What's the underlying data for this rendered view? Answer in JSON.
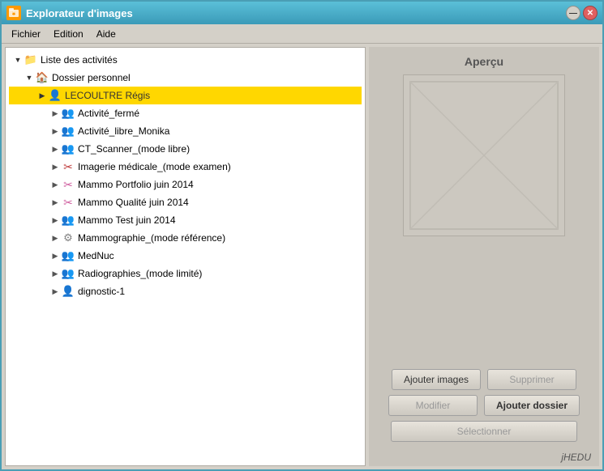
{
  "window": {
    "title": "Explorateur d'images",
    "icon": "🗂",
    "min_btn": "—",
    "close_btn": "✕"
  },
  "menubar": {
    "items": [
      {
        "label": "Fichier"
      },
      {
        "label": "Edition"
      },
      {
        "label": "Aide"
      }
    ]
  },
  "tree": {
    "root_label": "Liste des activités",
    "nodes": [
      {
        "id": "dossier_personnel",
        "label": "Dossier personnel",
        "level": 1,
        "expanded": true,
        "icon": "🏠",
        "icon_class": "icon-home"
      },
      {
        "id": "lecoultre",
        "label": "LECOULTRE Régis",
        "level": 2,
        "expanded": true,
        "icon": "👤",
        "icon_class": "icon-user-orange",
        "selected": true
      },
      {
        "id": "activite_ferme",
        "label": "Activité_fermé",
        "level": 3,
        "icon": "👥",
        "icon_class": "icon-users-blue"
      },
      {
        "id": "activite_libre_monika",
        "label": "Activité_libre_Monika",
        "level": 3,
        "icon": "👥",
        "icon_class": "icon-users-blue"
      },
      {
        "id": "ct_scanner",
        "label": "CT_Scanner_(mode libre)",
        "level": 3,
        "icon": "👥",
        "icon_class": "icon-users-blue"
      },
      {
        "id": "imagerie_medicale",
        "label": "Imagerie médicale_(mode examen)",
        "level": 3,
        "icon": "✂",
        "icon_class": "icon-medical"
      },
      {
        "id": "mammo_portfolio",
        "label": "Mammo Portfolio juin 2014",
        "level": 3,
        "icon": "✂",
        "icon_class": "icon-mammo-pink"
      },
      {
        "id": "mammo_qualite",
        "label": "Mammo Qualité juin 2014",
        "level": 3,
        "icon": "✂",
        "icon_class": "icon-mammo-pink"
      },
      {
        "id": "mammo_test",
        "label": "Mammo Test juin 2014",
        "level": 3,
        "icon": "👥",
        "icon_class": "icon-users-pink"
      },
      {
        "id": "mammographie",
        "label": "Mammographie_(mode référence)",
        "level": 3,
        "icon": "⚙",
        "icon_class": "icon-mammo-ref"
      },
      {
        "id": "mednuc",
        "label": "MedNuc",
        "level": 3,
        "icon": "👥",
        "icon_class": "icon-users-blue"
      },
      {
        "id": "radiographies",
        "label": "Radiographies_(mode limité)",
        "level": 3,
        "icon": "👥",
        "icon_class": "icon-users-blue"
      },
      {
        "id": "dignostic",
        "label": "dignostic-1",
        "level": 3,
        "icon": "👤",
        "icon_class": "icon-diag"
      }
    ]
  },
  "right_panel": {
    "apercu_label": "Aperçu",
    "buttons": {
      "ajouter_images": "Ajouter images",
      "supprimer": "Supprimer",
      "modifier": "Modifier",
      "ajouter_dossier": "Ajouter dossier",
      "selectionner": "Sélectionner"
    },
    "branding": "jHEDU"
  }
}
